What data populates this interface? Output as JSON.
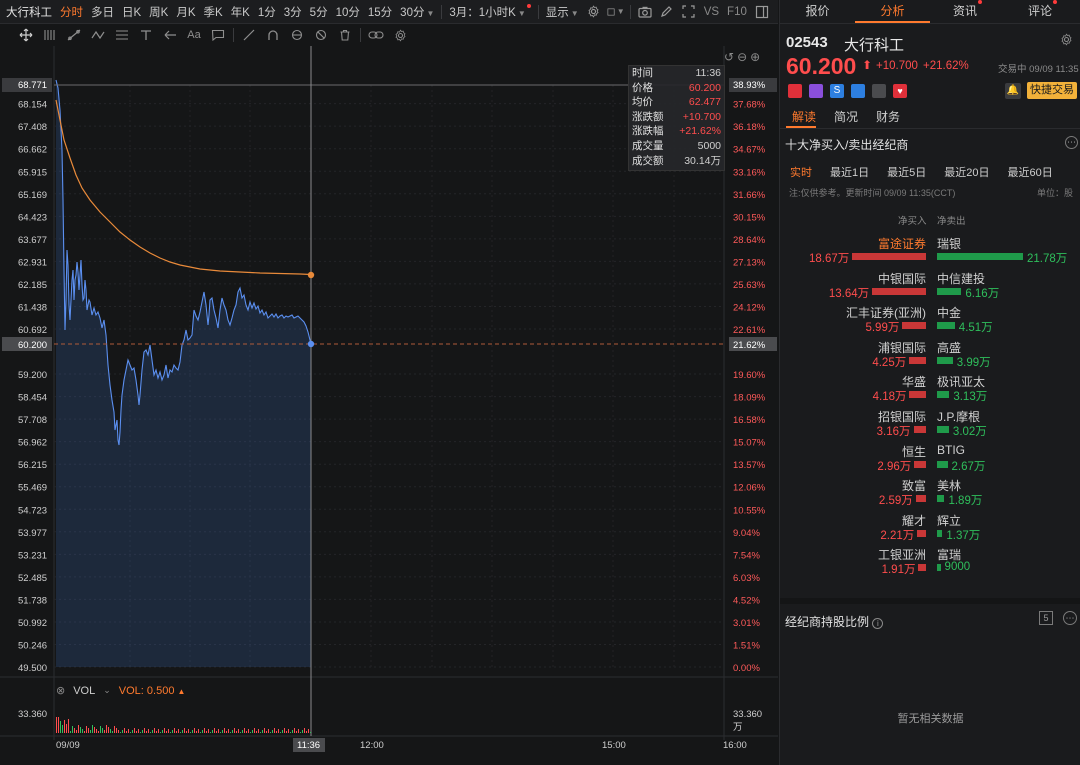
{
  "topbar": {
    "stock_name": "大行科工",
    "periods": [
      "分时",
      "多日",
      "日K",
      "周K",
      "月K",
      "季K",
      "年K",
      "1分",
      "3分",
      "5分",
      "10分",
      "15分",
      "30分"
    ],
    "active_period": "分时",
    "range_label": "3月：1小时K",
    "display_label": "显示",
    "vs_label": "VS",
    "f10_label": "F10"
  },
  "chart": {
    "left_axis": [
      "68.771",
      "68.154",
      "67.408",
      "66.662",
      "65.915",
      "65.169",
      "64.423",
      "63.677",
      "62.931",
      "62.185",
      "61.438",
      "60.692",
      "59.200",
      "58.454",
      "57.708",
      "56.962",
      "56.215",
      "55.469",
      "54.723",
      "53.977",
      "53.231",
      "52.485",
      "51.738",
      "50.992",
      "50.246",
      "49.500"
    ],
    "right_axis": [
      "38.93%",
      "37.68%",
      "36.18%",
      "34.67%",
      "33.16%",
      "31.66%",
      "30.15%",
      "28.64%",
      "27.13%",
      "25.63%",
      "24.12%",
      "22.61%",
      "19.60%",
      "18.09%",
      "16.58%",
      "15.07%",
      "13.57%",
      "12.06%",
      "10.55%",
      "9.04%",
      "7.54%",
      "6.03%",
      "4.52%",
      "3.01%",
      "1.51%",
      "0.00%"
    ],
    "current_price_tag": "60.200",
    "current_pct_tag": "21.62%",
    "x_labels": {
      "start": "09/09",
      "cursor": "11:36",
      "noon": "12:00",
      "t1500": "15:00",
      "t1600": "16:00"
    },
    "vol_label": "VOL",
    "vol_value": "VOL: 0.500",
    "vol_axis_left": "33.360",
    "vol_axis_right": "33.360",
    "vol_axis_right_unit": "万",
    "colors": {
      "price_line": "#5b8ff0",
      "avg_line": "#e98a3a",
      "up": "#ff4d4d",
      "down": "#2fbf5c"
    }
  },
  "tooltip": {
    "rows": [
      {
        "k": "时间",
        "v": "11:36"
      },
      {
        "k": "价格",
        "v": "60.200"
      },
      {
        "k": "均价",
        "v": "62.477"
      },
      {
        "k": "涨跌额",
        "v": "+10.700"
      },
      {
        "k": "涨跌幅",
        "v": "+21.62%"
      },
      {
        "k": "成交量",
        "v": "5000"
      },
      {
        "k": "成交额",
        "v": "30.14万"
      }
    ]
  },
  "rpanel": {
    "tabs": [
      "报价",
      "分析",
      "资讯",
      "评论"
    ],
    "active_tab": "分析",
    "code": "02543",
    "name": "大行科工",
    "price": "60.200",
    "arrow": "⬆",
    "change": "+10.700",
    "change_pct": "+21.62%",
    "status": "交易中 09/09 11:35",
    "quick_trade": "快捷交易",
    "subtabs": [
      "解读",
      "简况",
      "财务"
    ],
    "section_title": "十大净买入/卖出经纪商",
    "time_tabs": [
      "实时",
      "最近1日",
      "最近5日",
      "最近20日",
      "最近60日"
    ],
    "note": "注:仅供参考。更新时间 09/09 11:35(CCT)",
    "unit": "单位：股",
    "col_buy": "净买入",
    "col_sell": "净卖出",
    "brokers": [
      {
        "buy_name": "富途证券",
        "buy_val": "18.67万",
        "buy_amt": 18.67,
        "sell_name": "瑞银",
        "sell_val": "21.78万",
        "sell_amt": 21.78,
        "highlight": true
      },
      {
        "buy_name": "中银国际",
        "buy_val": "13.64万",
        "buy_amt": 13.64,
        "sell_name": "中信建投",
        "sell_val": "6.16万",
        "sell_amt": 6.16
      },
      {
        "buy_name": "汇丰证券(亚洲)",
        "buy_val": "5.99万",
        "buy_amt": 5.99,
        "sell_name": "中金",
        "sell_val": "4.51万",
        "sell_amt": 4.51
      },
      {
        "buy_name": "浦银国际",
        "buy_val": "4.25万",
        "buy_amt": 4.25,
        "sell_name": "高盛",
        "sell_val": "3.99万",
        "sell_amt": 3.99
      },
      {
        "buy_name": "华盛",
        "buy_val": "4.18万",
        "buy_amt": 4.18,
        "sell_name": "极讯亚太",
        "sell_val": "3.13万",
        "sell_amt": 3.13
      },
      {
        "buy_name": "招银国际",
        "buy_val": "3.16万",
        "buy_amt": 3.16,
        "sell_name": "J.P.摩根",
        "sell_val": "3.02万",
        "sell_amt": 3.02
      },
      {
        "buy_name": "恒生",
        "buy_val": "2.96万",
        "buy_amt": 2.96,
        "sell_name": "BTIG",
        "sell_val": "2.67万",
        "sell_amt": 2.67
      },
      {
        "buy_name": "致富",
        "buy_val": "2.59万",
        "buy_amt": 2.59,
        "sell_name": "美林",
        "sell_val": "1.89万",
        "sell_amt": 1.89
      },
      {
        "buy_name": "耀才",
        "buy_val": "2.21万",
        "buy_amt": 2.21,
        "sell_name": "辉立",
        "sell_val": "1.37万",
        "sell_amt": 1.37
      },
      {
        "buy_name": "工银亚洲",
        "buy_val": "1.91万",
        "buy_amt": 1.91,
        "sell_name": "富瑞",
        "sell_val": "9000",
        "sell_amt": 0.9
      }
    ],
    "holding_title": "经纪商持股比例",
    "holding_badge": "5",
    "empty_text": "暂无相关数据"
  }
}
